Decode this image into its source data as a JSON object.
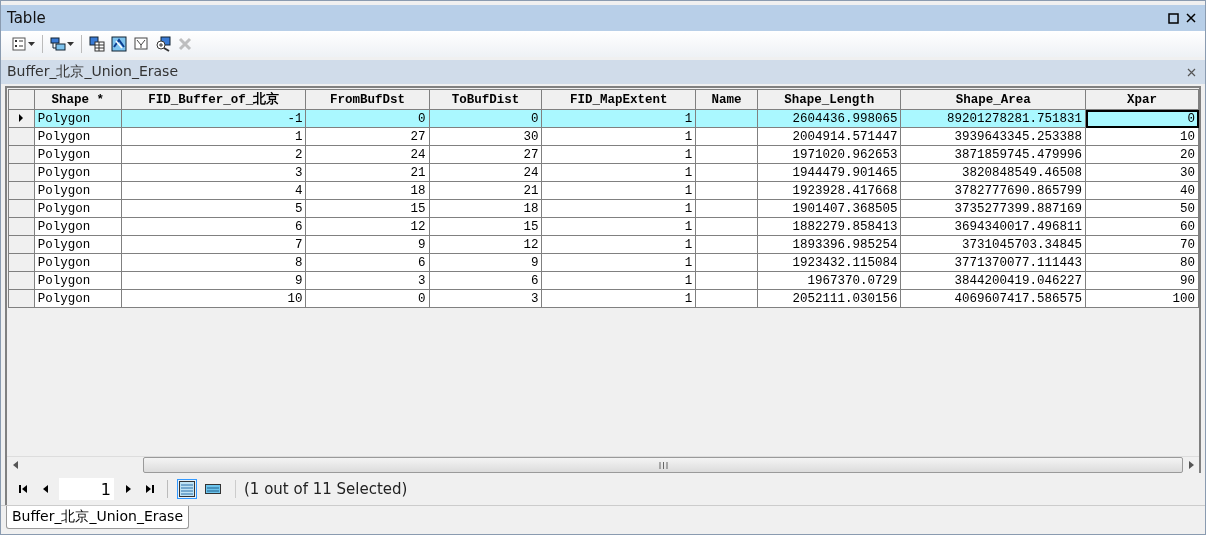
{
  "window": {
    "title": "Table"
  },
  "toolbar": [
    {
      "dropdown": true,
      "disabled": false
    },
    {
      "dropdown": true,
      "disabled": false
    },
    {
      "dropdown": false,
      "disabled": false
    },
    {
      "dropdown": false,
      "disabled": false
    },
    {
      "dropdown": false,
      "disabled": false
    },
    {
      "dropdown": false,
      "disabled": false
    },
    {
      "dropdown": false,
      "disabled": true
    }
  ],
  "table_tab": {
    "title": "Buffer_北京_Union_Erase"
  },
  "table": {
    "columns": [
      "Shape *",
      "FID_Buffer_of_北京",
      "FromBufDst",
      "ToBufDist",
      "FID_MapExtent",
      "Name",
      "Shape_Length",
      "Shape_Area",
      "Xpar"
    ],
    "rows": [
      {
        "selected": true,
        "current": true,
        "cells": [
          "Polygon",
          "-1",
          "0",
          "0",
          "1",
          null,
          "2604436.998065",
          "89201278281.751831",
          "0"
        ]
      },
      {
        "selected": false,
        "current": false,
        "cells": [
          "Polygon",
          "1",
          "27",
          "30",
          "1",
          null,
          "2004914.571447",
          "3939643345.253388",
          "10"
        ]
      },
      {
        "selected": false,
        "current": false,
        "cells": [
          "Polygon",
          "2",
          "24",
          "27",
          "1",
          null,
          "1971020.962653",
          "3871859745.479996",
          "20"
        ]
      },
      {
        "selected": false,
        "current": false,
        "cells": [
          "Polygon",
          "3",
          "21",
          "24",
          "1",
          null,
          "1944479.901465",
          "3820848549.46508",
          "30"
        ]
      },
      {
        "selected": false,
        "current": false,
        "cells": [
          "Polygon",
          "4",
          "18",
          "21",
          "1",
          null,
          "1923928.417668",
          "3782777690.865799",
          "40"
        ]
      },
      {
        "selected": false,
        "current": false,
        "cells": [
          "Polygon",
          "5",
          "15",
          "18",
          "1",
          null,
          "1901407.368505",
          "3735277399.887169",
          "50"
        ]
      },
      {
        "selected": false,
        "current": false,
        "cells": [
          "Polygon",
          "6",
          "12",
          "15",
          "1",
          null,
          "1882279.858413",
          "3694340017.496811",
          "60"
        ]
      },
      {
        "selected": false,
        "current": false,
        "cells": [
          "Polygon",
          "7",
          "9",
          "12",
          "1",
          null,
          "1893396.985254",
          "3731045703.34845",
          "70"
        ]
      },
      {
        "selected": false,
        "current": false,
        "cells": [
          "Polygon",
          "8",
          "6",
          "9",
          "1",
          null,
          "1923432.115084",
          "3771370077.111443",
          "80"
        ]
      },
      {
        "selected": false,
        "current": false,
        "cells": [
          "Polygon",
          "9",
          "3",
          "6",
          "1",
          null,
          "1967370.0729",
          "3844200419.046227",
          "90"
        ]
      },
      {
        "selected": false,
        "current": false,
        "cells": [
          "Polygon",
          "10",
          "0",
          "3",
          "1",
          null,
          "2052111.030156",
          "4069607417.586575",
          "100"
        ]
      }
    ]
  },
  "navigator": {
    "record": "1",
    "views": [
      {
        "selected": true
      },
      {
        "selected": false
      }
    ],
    "status": "(1 out of 11 Selected)"
  },
  "bottom_tabs": [
    {
      "label": "Buffer_北京_Union_Erase",
      "selected": true
    }
  ]
}
